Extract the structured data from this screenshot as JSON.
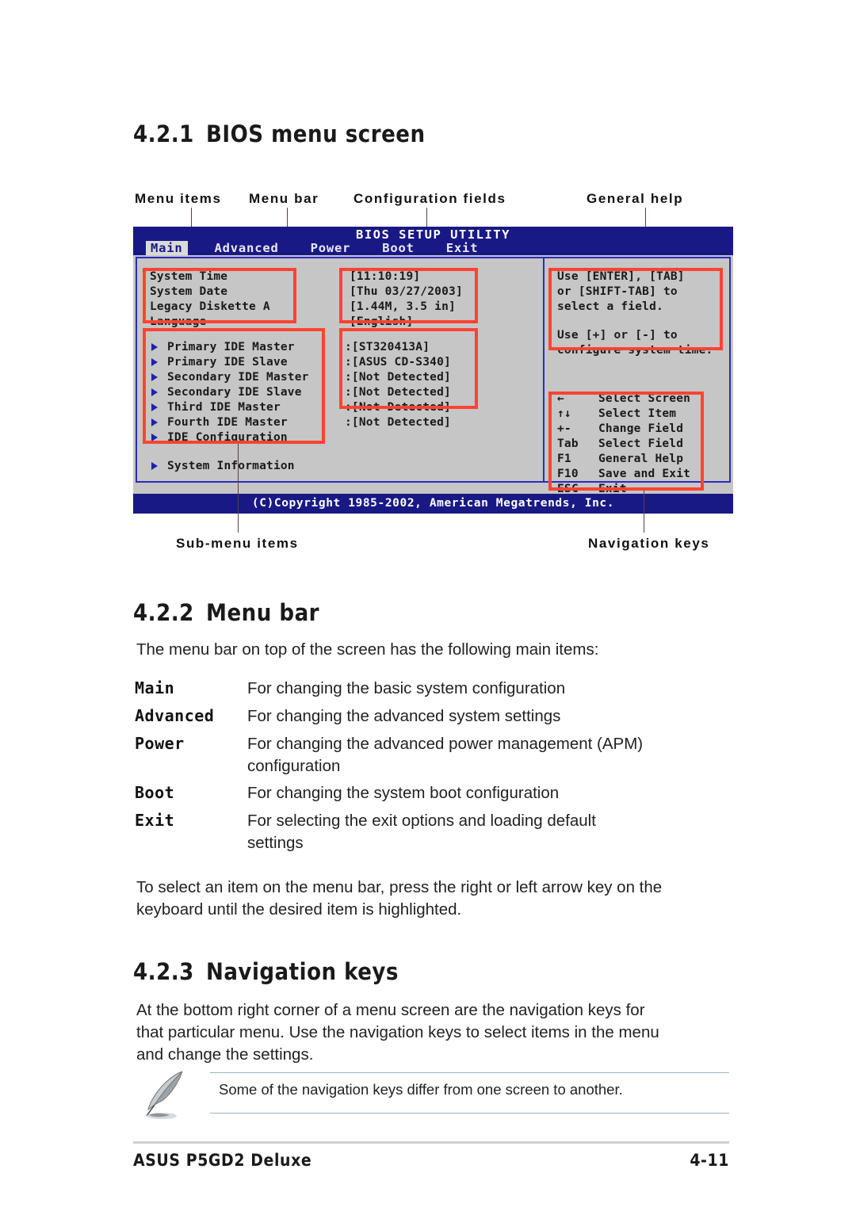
{
  "sections": {
    "s421": {
      "number": "4.2.1",
      "title": "BIOS menu screen"
    },
    "s422": {
      "number": "4.2.2",
      "title": "Menu bar"
    },
    "s423": {
      "number": "4.2.3",
      "title": "Navigation keys"
    }
  },
  "callouts": {
    "menu_items": "Menu items",
    "menu_bar": "Menu bar",
    "configuration_fields": "Configuration fields",
    "general_help": "General help",
    "sub_menu_items": "Sub-menu items",
    "navigation_keys": "Navigation keys"
  },
  "bios": {
    "title": "BIOS SETUP UTILITY",
    "tabs": [
      {
        "label": "Main",
        "active": true
      },
      {
        "label": "Advanced",
        "active": false
      },
      {
        "label": "Power",
        "active": false
      },
      {
        "label": "Boot",
        "active": false
      },
      {
        "label": "Exit",
        "active": false
      }
    ],
    "settings": [
      {
        "name": "System Time",
        "value": "[11:10:19]"
      },
      {
        "name": "System Date",
        "value": "[Thu 03/27/2003]"
      },
      {
        "name": "Legacy Diskette A",
        "value": "[1.44M, 3.5 in]"
      },
      {
        "name": "Language",
        "value": "[English]"
      }
    ],
    "submenus": [
      {
        "name": "Primary IDE Master",
        "value": ":[ST320413A]"
      },
      {
        "name": "Primary IDE Slave",
        "value": ":[ASUS CD-S340]"
      },
      {
        "name": "Secondary IDE Master",
        "value": ":[Not Detected]"
      },
      {
        "name": "Secondary IDE Slave",
        "value": ":[Not Detected]"
      },
      {
        "name": "Third IDE Master",
        "value": ":[Not Detected]"
      },
      {
        "name": "Fourth IDE Master",
        "value": ":[Not Detected]"
      },
      {
        "name": "IDE Configuration",
        "value": ""
      }
    ],
    "system_information": "System Information",
    "help": {
      "line1": "Use [ENTER], [TAB]",
      "line2": "or [SHIFT-TAB] to",
      "line3": "select a field.",
      "line4": "Use [+] or [-] to",
      "line5": "configure system time."
    },
    "nav_keys": [
      {
        "key": "←",
        "label": "Select Screen"
      },
      {
        "key": "↑↓",
        "label": "Select Item"
      },
      {
        "key": "+-",
        "label": "Change Field"
      },
      {
        "key": "Tab",
        "label": "Select Field"
      },
      {
        "key": "F1",
        "label": "General Help"
      },
      {
        "key": "F10",
        "label": "Save and Exit"
      },
      {
        "key": "ESC",
        "label": "Exit"
      }
    ],
    "copyright": "(C)Copyright 1985-2002, American Megatrends, Inc."
  },
  "menu_bar_section": {
    "intro": "The menu bar on top of the screen has the following main items:",
    "items": [
      {
        "term": "Main",
        "def_line1": "For changing the basic system configuration",
        "def_line2": ""
      },
      {
        "term": "Advanced",
        "def_line1": "For changing the advanced system settings",
        "def_line2": ""
      },
      {
        "term": "Power",
        "def_line1": "For changing the advanced power management (APM)",
        "def_line2": "configuration"
      },
      {
        "term": "Boot",
        "def_line1": "For changing the system boot configuration",
        "def_line2": ""
      },
      {
        "term": "Exit",
        "def_line1": "For selecting the exit options and loading default",
        "def_line2": "settings"
      }
    ],
    "outro_line1": "To select an item on the menu bar, press the right or left arrow key on the",
    "outro_line2": "keyboard until the desired item is highlighted."
  },
  "navigation_keys_section": {
    "para_line1": "At the bottom right corner of a menu screen are the navigation keys for",
    "para_line2": "that particular menu. Use the navigation keys to select items in the menu",
    "para_line3": "and change the settings.",
    "note": "Some of the navigation keys differ from one screen to another."
  },
  "footer": {
    "left": "ASUS P5GD2 Deluxe",
    "right": "4-11"
  },
  "colors": {
    "bios_blue": "#191985",
    "bios_gray": "#c6c6c6",
    "annotation_red": "#fc4432",
    "border_blue": "#2b2bbe"
  }
}
